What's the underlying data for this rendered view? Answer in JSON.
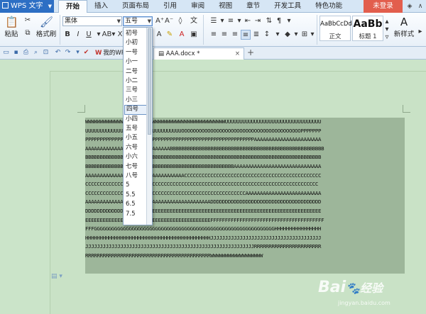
{
  "app": {
    "title": "WPS 文字"
  },
  "menu": {
    "tabs": [
      "开始",
      "插入",
      "页面布局",
      "引用",
      "审阅",
      "视图",
      "章节",
      "开发工具",
      "特色功能"
    ],
    "login": "未登录"
  },
  "ribbon": {
    "paste": "粘贴",
    "format_painter": "格式刷",
    "font_name": "黑体",
    "font_size": "五号",
    "styles": [
      {
        "sample": "AaBbCcDd",
        "name": "正文"
      },
      {
        "sample": "AaBb",
        "name": "标题 1"
      }
    ],
    "new_style": "新样式"
  },
  "tabs": {
    "home": "我的WPS",
    "document": "AAA.docx *"
  },
  "font_size_dropdown": {
    "items": [
      "初号",
      "小初",
      "一号",
      "小一",
      "二号",
      "小二",
      "三号",
      "小三",
      "四号",
      "小四",
      "五号",
      "小五",
      "六号",
      "小六",
      "七号",
      "八号",
      "5",
      "5.5",
      "6.5",
      "7.5"
    ],
    "selected": "四号"
  },
  "document": {
    "lines": [
      "WWWWWWWWWWWWWWWWWWWWWWWWWWWWWWWWWWWWWWWWWWWWWWWWUUUUUUUUUUUUUUUUUUUUUUUUUUUUUUUUU",
      "UUUUUUUUUUUUUUUUUUUUUUUUUUUUUUUUUOOOOOOOOOOOOOOOOOOOOOOOOOOOOOOOOOOOOOOOOOPPPPPPP",
      "PPPPPPPPPPPPPPPPPPPPPPPPPPPPPPPPPPPPPPPPPPPPPPPPPPPPPPPPPPAAAAAAAAAAAAAAAAAAAAAAA",
      "AAAAAAAAAAAAAAAAAAAAAAAAAAAAABBBBBBBBBBBBBBBBBBBBBBBBBBBBBBBBBBBBBBBBBBBBBBBBBBBBB",
      "BBBBBBBBBBBBBBBBBBBBBBBBBBBBBBBBBBBBBBBBBBBBBBBBBBBBBBBBBBBBBBBBBBBBBBBBBBBBBBBBB",
      "BBBBBBBBBBBBBBBBBBBBBBBBBBBBBBBBBBBBBBBBBBBBBBBBBBBAAAAAAAAAAAAAAAAAAAAAAAAAAAAAA",
      "AAAAAAAAAAAAAAAAAAAAAAAAAAAAAAAAAACCCCCCCCCCCCCCCCCCCCCCCCCCCCCCCCCCCCCCCCCCCCCCC",
      "CCCCCCCCCCCCCCCCCCCCCCCCCCCCCCCCCCCCCCCCCCCCCCCCCCCCCCCCCCCCCCCCCCCCCCCCCCCCCCCC",
      "CCCCCCCCCCCCCCCCCCCCCCCCCCCCCCCCCCCCCCCCCCCCCCCCCCCCCCCAAAAAAAAAAAAAAAAAAAAAAAAAA",
      "AAAAAAAAAAAAAAAAAAAAAAAAAAAAAAAAAAAAAAAAAAADDDDDDDDDDDDDDDDDDDDDDDDDDDDDDDDDDDDDD",
      "DDDDDDDDDDDDDDDDDDDDDEEEEEEEEEEEEEEEEEEEEEEEEEEEEEEEEEEEEEEEEEEEEEEEEEEEEEEEEEEEE",
      "EEEEEEEEEEEEEEEEEEEEEEEEEEEEEEEEEEEEEEEEEEEFFFFFFFFFFFFFFFFFFFFFFFFFFFFFFFFFFFFFFF",
      "FFFGGGGGGGGGGGGGGGGGGGGGGGGGGGGGGGGGGGGGGGGGGGGGGGGGGGGGGGGGGGGGGHHHHHHHHHHHHHHHH",
      "HHHHHHHHHHHHHHHHHHHHHHHHHHHHHHHHHHHHHHHHHHHJJJJJJJJJJJJJJJJJJJJJJJJJJJJJJJJJJJJJJ",
      "JJJJJJJJJJJJJJJJJJJJJJJJJJJJJJJJJJJJJJJJJJJJJJJJJJJJJJJJJJRRRRRRRRRRRRRRRRRRRRRRR",
      "RRRRRRRRRRRRRRRRRRRRRRRRRRRRRRRRRRRRRRRRRRRWWWWWWWWWWWWWWWWWW"
    ]
  },
  "watermark": {
    "logo": "Bai",
    "logo_suffix": "经验",
    "url": "jingyan.baidu.com"
  }
}
